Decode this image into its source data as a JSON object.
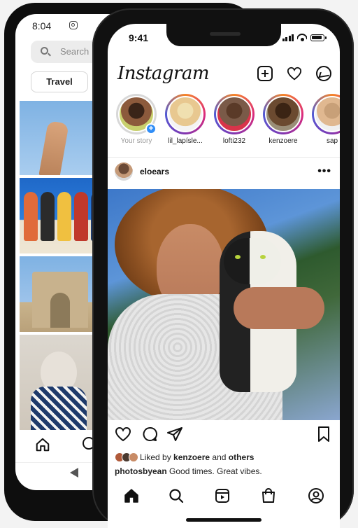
{
  "back_phone": {
    "status_time": "8:04",
    "search_placeholder": "Search",
    "chip_label": "Travel"
  },
  "front_phone": {
    "status_time": "9:41",
    "app_name": "Instagram",
    "stories": [
      {
        "label": "Your story",
        "muted": true
      },
      {
        "label": "lil_lapísle..."
      },
      {
        "label": "lofti232"
      },
      {
        "label": "kenzoere"
      },
      {
        "label": "sap"
      }
    ],
    "post": {
      "username": "eloears",
      "more": "•••",
      "likes_prefix": "Liked by",
      "likes_user": "kenzoere",
      "likes_and": "and",
      "likes_suffix": "others",
      "caption_user": "photosbyean",
      "caption_text": "Good times. Great vibes."
    }
  },
  "colors": {
    "story_ring": "#dd2a7b",
    "plus_badge": "#2f8df7"
  },
  "icons": [
    "instagram-icon",
    "search-icon",
    "home-icon",
    "add-icon",
    "heart-icon",
    "messenger-icon",
    "comment-icon",
    "share-icon",
    "save-icon",
    "reels-icon",
    "shop-icon",
    "profile-icon"
  ]
}
